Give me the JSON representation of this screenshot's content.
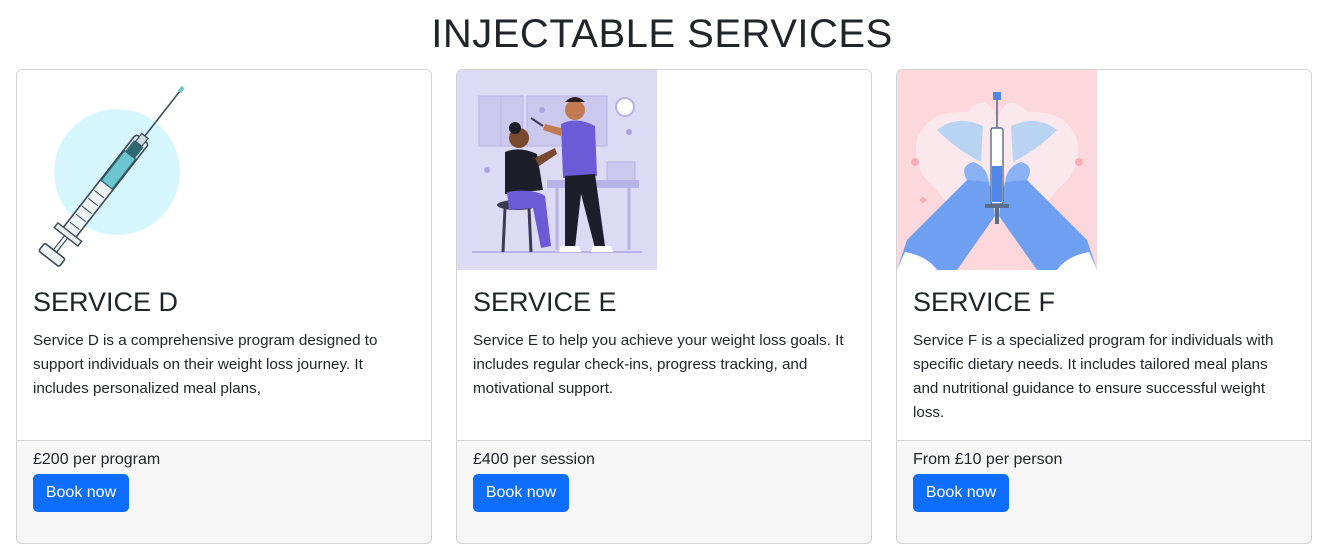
{
  "page": {
    "title": "INJECTABLE SERVICES"
  },
  "cards": [
    {
      "title": "SERVICE D",
      "description": "Service D is a comprehensive program designed to support individuals on their weight loss journey. It includes personalized meal plans,",
      "price": "£200 per program",
      "button_label": "Book now",
      "image_icon": "syringe-illustration"
    },
    {
      "title": "SERVICE E",
      "description": "Service E to help you achieve your weight loss goals. It includes regular check-ins, progress tracking, and motivational support.",
      "price": "£400 per session",
      "button_label": "Book now",
      "image_icon": "vaccination-illustration"
    },
    {
      "title": "SERVICE F",
      "description": "Service F is a specialized program for individuals with specific dietary needs. It includes tailored meal plans and nutritional guidance to ensure successful weight loss.",
      "price": "From £10 per person",
      "button_label": "Book now",
      "image_icon": "gloved-hands-syringe-illustration"
    }
  ],
  "colors": {
    "button": "#0d6efd",
    "footer_bg": "#f7f7f7",
    "card_border": "#d3d3d3",
    "text": "#212529"
  }
}
